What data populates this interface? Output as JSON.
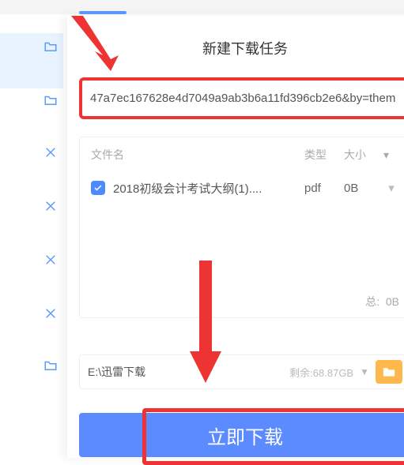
{
  "dialog": {
    "title": "新建下载任务",
    "url_value": "47a7ec167628e4d7049a9ab3b6a11fd396cb2e6&by=them",
    "headers": {
      "name": "文件名",
      "type": "类型",
      "size": "大小"
    },
    "files": [
      {
        "checked": true,
        "name": "2018初级会计考试大纲(1)....",
        "type": "pdf",
        "size": "0B"
      }
    ],
    "total_label": "总:",
    "total_size": "0B",
    "path": {
      "value": "E:\\迅雷下载",
      "remaining": "剩余:68.87GB"
    },
    "download_label": "立即下载"
  },
  "colors": {
    "accent": "#5b8bff",
    "danger": "#e33"
  }
}
